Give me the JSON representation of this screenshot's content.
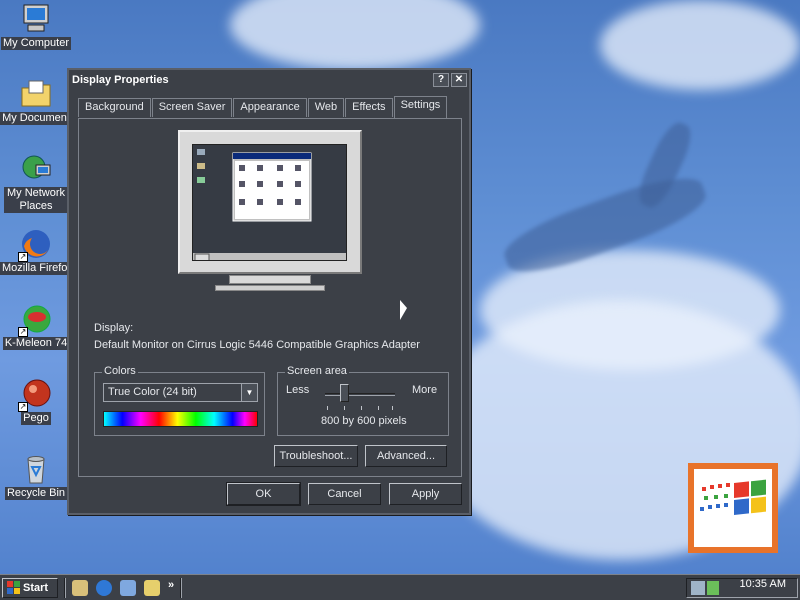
{
  "desktop": {
    "icons": [
      {
        "label": "My Computer",
        "icon": "computer-icon"
      },
      {
        "label": "My Document",
        "icon": "documents-folder-icon"
      },
      {
        "label": "My Network Places",
        "icon": "network-places-icon"
      },
      {
        "label": "Mozilla Firefox",
        "icon": "firefox-icon"
      },
      {
        "label": "K-Meleon 74",
        "icon": "k-meleon-icon"
      },
      {
        "label": "Pego",
        "icon": "pego-icon"
      },
      {
        "label": "Recycle Bin",
        "icon": "recycle-bin-icon"
      }
    ]
  },
  "window": {
    "title": "Display Properties",
    "help_btn": "?",
    "close_btn": "✕",
    "tabs": [
      "Background",
      "Screen Saver",
      "Appearance",
      "Web",
      "Effects",
      "Settings"
    ],
    "active_tab": "Settings",
    "display_label": "Display:",
    "display_value": "Default Monitor on Cirrus Logic 5446 Compatible Graphics Adapter",
    "colors": {
      "legend": "Colors",
      "selected": "True Color (24 bit)"
    },
    "screen_area": {
      "legend": "Screen area",
      "less": "Less",
      "more": "More",
      "value": "800 by 600 pixels"
    },
    "buttons": {
      "troubleshoot": "Troubleshoot...",
      "advanced": "Advanced...",
      "ok": "OK",
      "cancel": "Cancel",
      "apply": "Apply"
    }
  },
  "taskbar": {
    "start": "Start",
    "quick_launch_more": "»",
    "clock": "10:35 AM"
  },
  "colors": {
    "window_bg": "#3c4047",
    "desktop_sky": "#5f8fd4",
    "logo_frame": "#e8732a"
  }
}
